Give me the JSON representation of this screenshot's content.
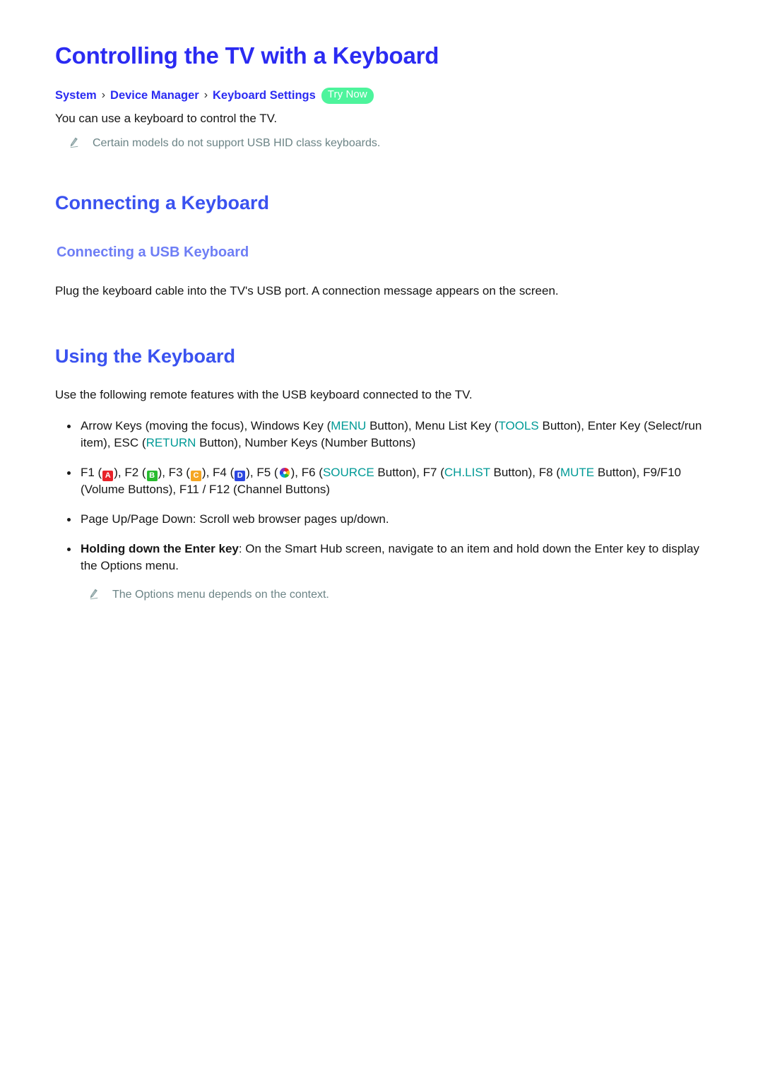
{
  "page": {
    "title": "Controlling the TV with a Keyboard"
  },
  "breadcrumb": {
    "items": [
      "System",
      "Device Manager",
      "Keyboard Settings"
    ],
    "separator": "›",
    "badge": "Try Now"
  },
  "intro": {
    "text": "You can use a keyboard to control the TV.",
    "note_icon": "pencil-icon",
    "note": "Certain models do not support USB HID class keyboards."
  },
  "section_connecting": {
    "heading": "Connecting a Keyboard",
    "subheading": "Connecting a USB Keyboard",
    "paragraph": "Plug the keyboard cable into the TV's USB port. A connection message appears on the screen."
  },
  "section_using": {
    "heading": "Using the Keyboard",
    "intro": "Use the following remote features with the USB keyboard connected to the TV.",
    "bullets": [
      {
        "id": "arrow-keys",
        "parts": [
          {
            "t": "Arrow Keys (moving the focus), Windows Key ("
          },
          {
            "t": "MENU",
            "style": "accent"
          },
          {
            "t": " Button), Menu List Key ("
          },
          {
            "t": "TOOLS",
            "style": "accent"
          },
          {
            "t": " Button), Enter Key (Select/run item), ESC ("
          },
          {
            "t": "RETURN",
            "style": "accent"
          },
          {
            "t": " Button), Number Keys (Number Buttons)"
          }
        ]
      },
      {
        "id": "function-keys",
        "parts": [
          {
            "t": "F1 ("
          },
          {
            "t": "A",
            "style": "key-red"
          },
          {
            "t": "), F2 ("
          },
          {
            "t": "B",
            "style": "key-green"
          },
          {
            "t": "), F3 ("
          },
          {
            "t": "C",
            "style": "key-yellow"
          },
          {
            "t": "), F4 ("
          },
          {
            "t": "D",
            "style": "key-blue"
          },
          {
            "t": "), F5 ("
          },
          {
            "t": "",
            "style": "smart-hub-icon"
          },
          {
            "t": "), F6 ("
          },
          {
            "t": "SOURCE",
            "style": "accent"
          },
          {
            "t": " Button), F7 ("
          },
          {
            "t": "CH.LIST",
            "style": "accent"
          },
          {
            "t": " Button), F8 ("
          },
          {
            "t": "MUTE",
            "style": "accent"
          },
          {
            "t": " Button), F9/F10 (Volume Buttons), F11 / F12 (Channel Buttons)"
          }
        ]
      },
      {
        "id": "page-up-down",
        "parts": [
          {
            "t": "Page Up/Page Down: Scroll web browser pages up/down."
          }
        ]
      },
      {
        "id": "holding-enter",
        "parts": [
          {
            "t": "Holding down the Enter key",
            "style": "bold"
          },
          {
            "t": ": On the Smart Hub screen, navigate to an item and hold down the Enter key to display the Options menu."
          }
        ]
      }
    ],
    "note_icon": "pencil-icon",
    "note": "The Options menu depends on the context."
  },
  "colors": {
    "title_blue": "#2b2bf2",
    "heading_blue": "#3a52f0",
    "subheading_blue": "#6e7ef5",
    "accent_teal": "#009a96",
    "badge_green": "#4df49c",
    "note_grey": "#6c8486",
    "key_red": "#e8232a",
    "key_green": "#27bb2f",
    "key_yellow": "#f5a623",
    "key_blue": "#2b46e0"
  }
}
